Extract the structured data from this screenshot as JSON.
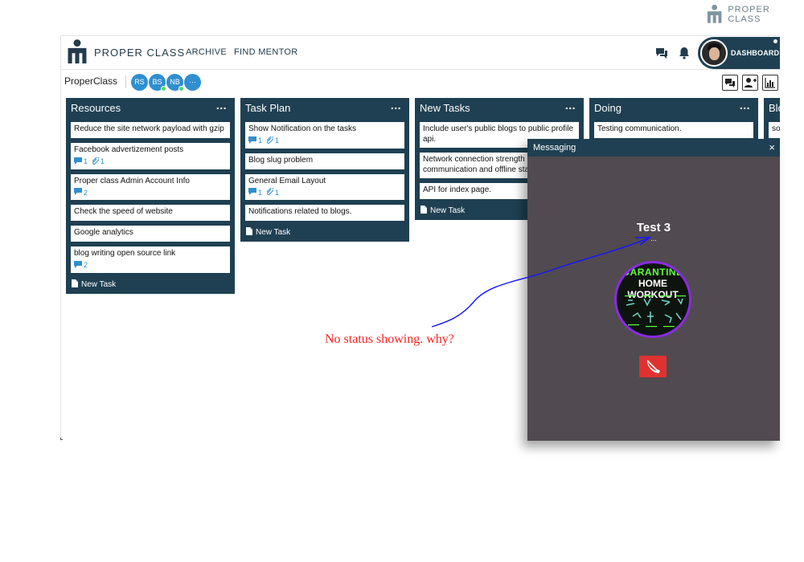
{
  "outer_brand": {
    "name": "PROPER CLASS"
  },
  "navbar": {
    "brand_name": "PROPER CLASS",
    "links": [
      "ARCHIVE",
      "FIND MENTOR"
    ],
    "dashboard_label": "DASHBOARD"
  },
  "board": {
    "title": "ProperClass",
    "members": [
      {
        "initials": "RS",
        "online": false
      },
      {
        "initials": "BS",
        "online": true
      },
      {
        "initials": "NB",
        "online": true
      },
      {
        "initials": "···",
        "online": false
      }
    ]
  },
  "lanes": [
    {
      "title": "Resources",
      "more": "...",
      "cards": [
        {
          "title": "Reduce the site network payload with gzip",
          "comments": "",
          "attachments": ""
        },
        {
          "title": "Facebook advertizement posts",
          "comments": "1",
          "attachments": "1"
        },
        {
          "title": "Proper class Admin Account Info",
          "comments": "2",
          "attachments": ""
        },
        {
          "title": "Check the speed of website",
          "comments": "",
          "attachments": ""
        },
        {
          "title": "Google analytics",
          "comments": "",
          "attachments": ""
        },
        {
          "title": "blog writing open source link",
          "comments": "2",
          "attachments": ""
        }
      ],
      "new_task": "New Task"
    },
    {
      "title": "Task Plan",
      "more": "...",
      "cards": [
        {
          "title": "Show Notification on the tasks",
          "comments": "1",
          "attachments": "1"
        },
        {
          "title": "Blog slug problem",
          "comments": "",
          "attachments": ""
        },
        {
          "title": "General Email Layout",
          "comments": "1",
          "attachments": "1"
        },
        {
          "title": "Notifications related to blogs.",
          "comments": "",
          "attachments": ""
        }
      ],
      "new_task": "New Task"
    },
    {
      "title": "New Tasks",
      "more": "...",
      "cards": [
        {
          "title": "Include user's public blogs to public profile api.",
          "comments": "",
          "attachments": ""
        },
        {
          "title": "Network connection strength communication and offline status",
          "comments": "",
          "attachments": ""
        },
        {
          "title": "API for index page.",
          "comments": "",
          "attachments": ""
        }
      ],
      "new_task": "New Task"
    },
    {
      "title": "Doing",
      "more": "...",
      "cards": [
        {
          "title": "Testing communication.",
          "comments": "",
          "attachments": ""
        }
      ],
      "new_task": ""
    },
    {
      "title": "Blo",
      "more": "",
      "cards": [
        {
          "title": "so",
          "comments": "",
          "attachments": ""
        }
      ],
      "new_task": ""
    }
  ],
  "messaging": {
    "title": "Messaging",
    "close": "×",
    "caller_name": "Test 3",
    "status": "...",
    "avatar_text_line1": "UARANTINE",
    "avatar_text_line2": "HOME WORKOUT"
  },
  "annotation": {
    "text": "No status showing. why?",
    "color": "#ff2020",
    "arrow_color": "#1414ff"
  },
  "colors": {
    "lane_bg": "#1f4052",
    "accent_blue": "#2f8fcf",
    "panel_bg": "#514a50",
    "hangup_red": "#e03131",
    "online_green": "#4cd964"
  }
}
